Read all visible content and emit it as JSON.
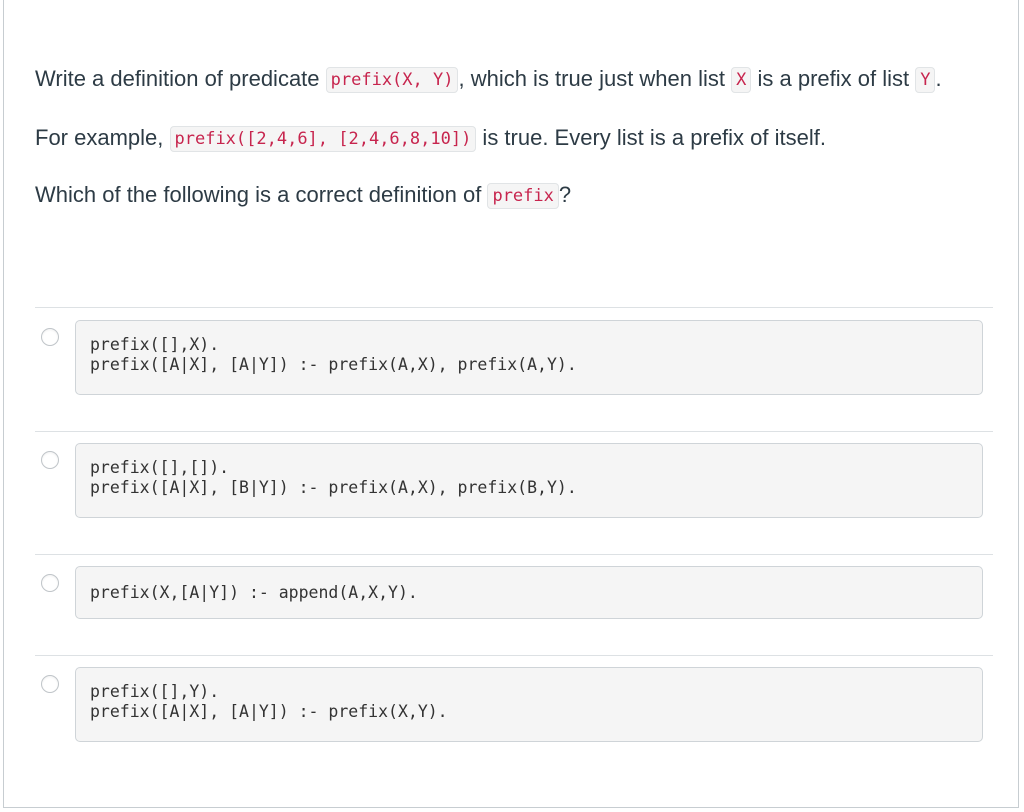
{
  "question": {
    "line1_part1": "Write a definition of predicate ",
    "line1_code1": "prefix(X, Y)",
    "line1_part2": ", which is true just when list ",
    "line1_code2": "X",
    "line1_part3": " is a prefix of list ",
    "line1_code3": "Y",
    "line1_part4": ".",
    "line2_part1": "For example, ",
    "line2_code1": "prefix([2,4,6], [2,4,6,8,10])",
    "line2_part2": " is true. Every list is a prefix of itself.",
    "line3_part1": "Which of the following is a correct definition of ",
    "line3_code1": "prefix",
    "line3_part2": "?"
  },
  "answers": [
    {
      "lines": [
        "prefix([],X).",
        "prefix([A|X], [A|Y]) :- prefix(A,X), prefix(A,Y)."
      ]
    },
    {
      "lines": [
        "prefix([],[]).",
        "prefix([A|X], [B|Y]) :- prefix(A,X), prefix(B,Y)."
      ]
    },
    {
      "lines": [
        "prefix(X,[A|Y]) :- append(A,X,Y)."
      ]
    },
    {
      "lines": [
        "prefix([],Y).",
        "prefix([A|X], [A|Y]) :- prefix(X,Y)."
      ]
    }
  ]
}
